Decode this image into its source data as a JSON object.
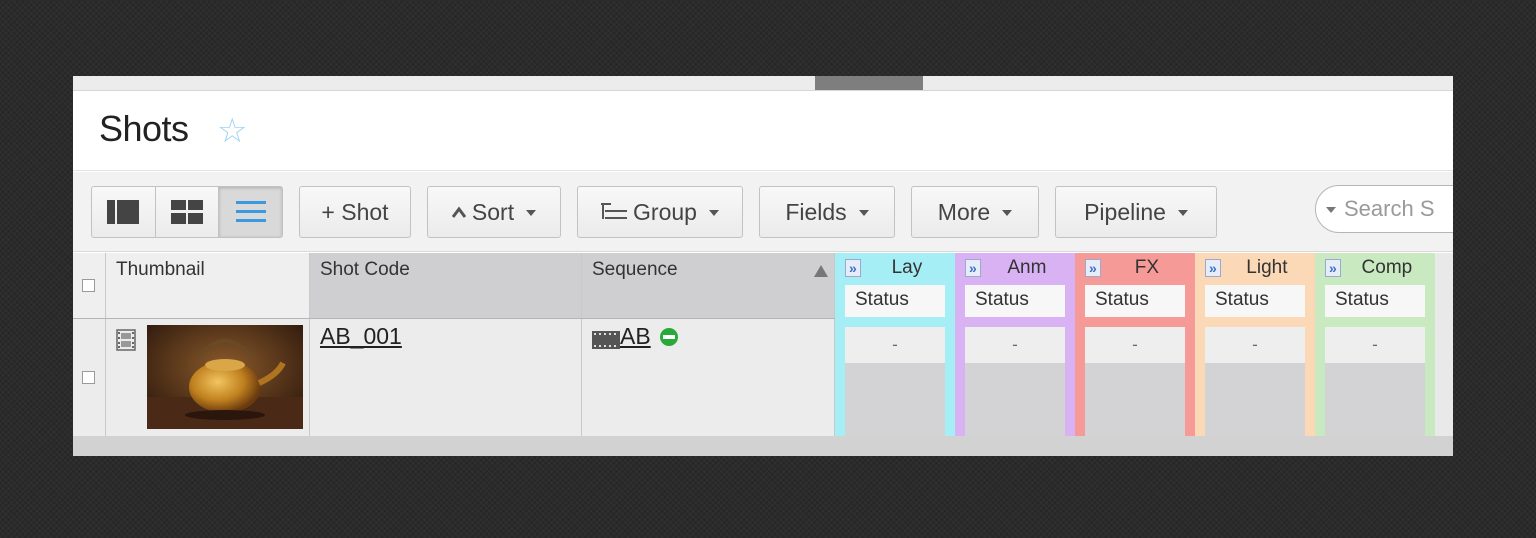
{
  "page": {
    "title": "Shots"
  },
  "toolbar": {
    "add_shot": "+ Shot",
    "sort": "Sort",
    "group": "Group",
    "fields": "Fields",
    "more": "More",
    "pipeline": "Pipeline",
    "search_placeholder": "Search S"
  },
  "columns": {
    "thumbnail": "Thumbnail",
    "shot_code": "Shot Code",
    "sequence": "Sequence"
  },
  "pipeline_steps": [
    {
      "label": "Lay",
      "sub": "Status",
      "value": "-",
      "color": "#a6eef5"
    },
    {
      "label": "Anm",
      "sub": "Status",
      "value": "-",
      "color": "#d8b2f3"
    },
    {
      "label": "FX",
      "sub": "Status",
      "value": "-",
      "color": "#f59a96"
    },
    {
      "label": "Light",
      "sub": "Status",
      "value": "-",
      "color": "#fbd8b6"
    },
    {
      "label": "Comp",
      "sub": "Status",
      "value": "-",
      "color": "#c9e9c1"
    }
  ],
  "rows": [
    {
      "shot_code": "AB_001",
      "sequence": "AB"
    }
  ],
  "colors": {
    "accent": "#3b99e0",
    "status_green": "#29a93a"
  },
  "icons": [
    "star-icon",
    "column-view-icon",
    "grid-view-icon",
    "list-view-icon",
    "sort-arrow-icon",
    "group-icon",
    "film-icon",
    "sequence-icon",
    "status-icon",
    "expand-icon"
  ]
}
